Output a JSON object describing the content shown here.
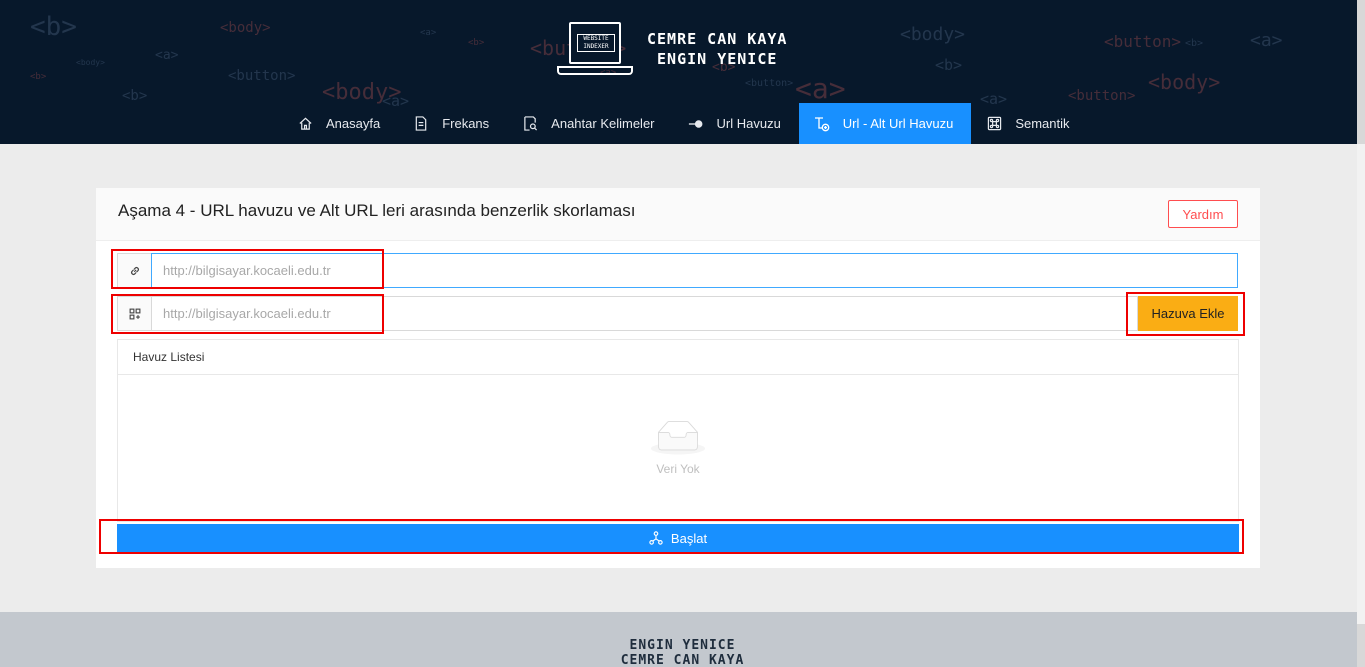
{
  "header": {
    "logo_screen_text": "WEBSITE INDEXER",
    "logo_line1": "CEMRE CAN KAYA",
    "logo_line2": "ENGIN YENICE",
    "bg_tags": [
      "<b>",
      "<body>",
      "<a>",
      "<button>",
      "<b>",
      "<body>",
      "<a>",
      "<b>",
      "<a>",
      "<button>",
      "<b>",
      "<body>",
      "<a>",
      "<b>",
      "<button>",
      "<a>",
      "<body>",
      "<b>",
      "<a>",
      "<button>",
      "<b>",
      "<a>",
      "<body>",
      "<button>"
    ]
  },
  "nav": {
    "items": [
      {
        "label": "Anasayfa",
        "icon": "home-icon"
      },
      {
        "label": "Frekans",
        "icon": "file-icon"
      },
      {
        "label": "Anahtar Kelimeler",
        "icon": "file-search-icon"
      },
      {
        "label": "Url Havuzu",
        "icon": "key-icon"
      },
      {
        "label": "Url - Alt Url Havuzu",
        "icon": "subnode-icon",
        "active": true
      },
      {
        "label": "Semantik",
        "icon": "command-icon"
      }
    ]
  },
  "card": {
    "title": "Aşama 4 - URL havuzu ve Alt URL leri arasında benzerlik skorlaması",
    "help_label": "Yardım",
    "main_url": {
      "placeholder": "http://bilgisayar.kocaeli.edu.tr",
      "value": ""
    },
    "sub_url": {
      "placeholder": "http://bilgisayar.kocaeli.edu.tr",
      "value": ""
    },
    "add_label": "Hazuva Ekle",
    "pool_title": "Havuz Listesi",
    "empty_text": "Veri Yok",
    "start_label": "Başlat"
  },
  "footer": {
    "line1": "ENGIN YENICE",
    "line2": "CEMRE CAN KAYA"
  },
  "colors": {
    "header_bg": "#07182b",
    "accent": "#1890ff",
    "warning": "#faad14",
    "danger": "#ff4d4f",
    "highlight": "#ee0000"
  }
}
